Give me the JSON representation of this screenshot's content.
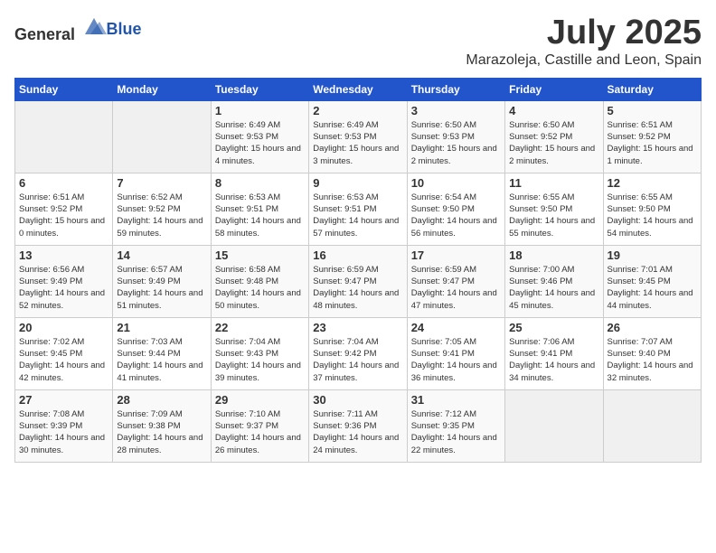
{
  "header": {
    "logo_general": "General",
    "logo_blue": "Blue",
    "month_year": "July 2025",
    "location": "Marazoleja, Castille and Leon, Spain"
  },
  "days_of_week": [
    "Sunday",
    "Monday",
    "Tuesday",
    "Wednesday",
    "Thursday",
    "Friday",
    "Saturday"
  ],
  "weeks": [
    [
      {
        "day": "",
        "empty": true
      },
      {
        "day": "",
        "empty": true
      },
      {
        "day": "1",
        "sunrise": "6:49 AM",
        "sunset": "9:53 PM",
        "daylight": "15 hours and 4 minutes."
      },
      {
        "day": "2",
        "sunrise": "6:49 AM",
        "sunset": "9:53 PM",
        "daylight": "15 hours and 3 minutes."
      },
      {
        "day": "3",
        "sunrise": "6:50 AM",
        "sunset": "9:53 PM",
        "daylight": "15 hours and 2 minutes."
      },
      {
        "day": "4",
        "sunrise": "6:50 AM",
        "sunset": "9:52 PM",
        "daylight": "15 hours and 2 minutes."
      },
      {
        "day": "5",
        "sunrise": "6:51 AM",
        "sunset": "9:52 PM",
        "daylight": "15 hours and 1 minute."
      }
    ],
    [
      {
        "day": "6",
        "sunrise": "6:51 AM",
        "sunset": "9:52 PM",
        "daylight": "15 hours and 0 minutes."
      },
      {
        "day": "7",
        "sunrise": "6:52 AM",
        "sunset": "9:52 PM",
        "daylight": "14 hours and 59 minutes."
      },
      {
        "day": "8",
        "sunrise": "6:53 AM",
        "sunset": "9:51 PM",
        "daylight": "14 hours and 58 minutes."
      },
      {
        "day": "9",
        "sunrise": "6:53 AM",
        "sunset": "9:51 PM",
        "daylight": "14 hours and 57 minutes."
      },
      {
        "day": "10",
        "sunrise": "6:54 AM",
        "sunset": "9:50 PM",
        "daylight": "14 hours and 56 minutes."
      },
      {
        "day": "11",
        "sunrise": "6:55 AM",
        "sunset": "9:50 PM",
        "daylight": "14 hours and 55 minutes."
      },
      {
        "day": "12",
        "sunrise": "6:55 AM",
        "sunset": "9:50 PM",
        "daylight": "14 hours and 54 minutes."
      }
    ],
    [
      {
        "day": "13",
        "sunrise": "6:56 AM",
        "sunset": "9:49 PM",
        "daylight": "14 hours and 52 minutes."
      },
      {
        "day": "14",
        "sunrise": "6:57 AM",
        "sunset": "9:49 PM",
        "daylight": "14 hours and 51 minutes."
      },
      {
        "day": "15",
        "sunrise": "6:58 AM",
        "sunset": "9:48 PM",
        "daylight": "14 hours and 50 minutes."
      },
      {
        "day": "16",
        "sunrise": "6:59 AM",
        "sunset": "9:47 PM",
        "daylight": "14 hours and 48 minutes."
      },
      {
        "day": "17",
        "sunrise": "6:59 AM",
        "sunset": "9:47 PM",
        "daylight": "14 hours and 47 minutes."
      },
      {
        "day": "18",
        "sunrise": "7:00 AM",
        "sunset": "9:46 PM",
        "daylight": "14 hours and 45 minutes."
      },
      {
        "day": "19",
        "sunrise": "7:01 AM",
        "sunset": "9:45 PM",
        "daylight": "14 hours and 44 minutes."
      }
    ],
    [
      {
        "day": "20",
        "sunrise": "7:02 AM",
        "sunset": "9:45 PM",
        "daylight": "14 hours and 42 minutes."
      },
      {
        "day": "21",
        "sunrise": "7:03 AM",
        "sunset": "9:44 PM",
        "daylight": "14 hours and 41 minutes."
      },
      {
        "day": "22",
        "sunrise": "7:04 AM",
        "sunset": "9:43 PM",
        "daylight": "14 hours and 39 minutes."
      },
      {
        "day": "23",
        "sunrise": "7:04 AM",
        "sunset": "9:42 PM",
        "daylight": "14 hours and 37 minutes."
      },
      {
        "day": "24",
        "sunrise": "7:05 AM",
        "sunset": "9:41 PM",
        "daylight": "14 hours and 36 minutes."
      },
      {
        "day": "25",
        "sunrise": "7:06 AM",
        "sunset": "9:41 PM",
        "daylight": "14 hours and 34 minutes."
      },
      {
        "day": "26",
        "sunrise": "7:07 AM",
        "sunset": "9:40 PM",
        "daylight": "14 hours and 32 minutes."
      }
    ],
    [
      {
        "day": "27",
        "sunrise": "7:08 AM",
        "sunset": "9:39 PM",
        "daylight": "14 hours and 30 minutes."
      },
      {
        "day": "28",
        "sunrise": "7:09 AM",
        "sunset": "9:38 PM",
        "daylight": "14 hours and 28 minutes."
      },
      {
        "day": "29",
        "sunrise": "7:10 AM",
        "sunset": "9:37 PM",
        "daylight": "14 hours and 26 minutes."
      },
      {
        "day": "30",
        "sunrise": "7:11 AM",
        "sunset": "9:36 PM",
        "daylight": "14 hours and 24 minutes."
      },
      {
        "day": "31",
        "sunrise": "7:12 AM",
        "sunset": "9:35 PM",
        "daylight": "14 hours and 22 minutes."
      },
      {
        "day": "",
        "empty": true
      },
      {
        "day": "",
        "empty": true
      }
    ]
  ]
}
